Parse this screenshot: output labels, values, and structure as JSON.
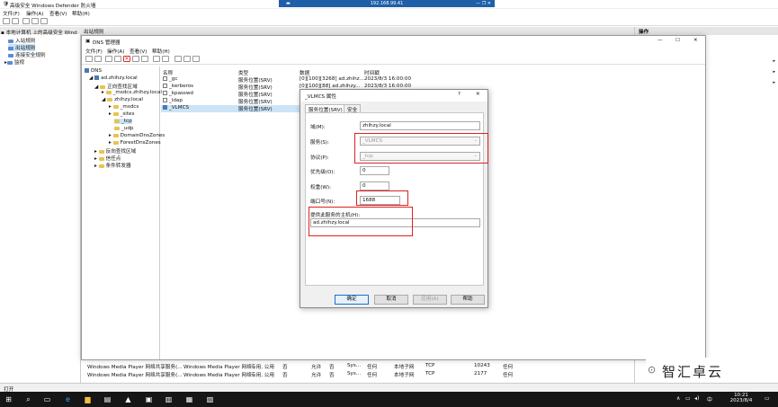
{
  "rdp": {
    "host": "192.168.99.41"
  },
  "firewall": {
    "title": "高级安全 Windows Defender 防火墙",
    "menu": [
      "文件(F)",
      "操作(A)",
      "查看(V)",
      "帮助(H)"
    ],
    "tree_root": "本地计算机 上的高级安全 Wind",
    "tree_items": [
      "入站规则",
      "出站规则",
      "连接安全规则",
      "监视"
    ],
    "center_header": "出站规则",
    "actions_header": "操作",
    "rows": [
      [
        "Windows Media Player 网络共享服务(...",
        "Windows Media Player 网络...",
        "专用, 公用",
        "否",
        "允许",
        "否",
        "Sys...",
        "任何",
        "本地子网",
        "TCP",
        "10243",
        "任何"
      ],
      [
        "Windows Media Player 网络共享服务(...",
        "Windows Media Player 网络...",
        "专用, 公用",
        "否",
        "允许",
        "否",
        "Sys...",
        "任何",
        "本地子网",
        "TCP",
        "2177",
        "任何"
      ]
    ],
    "status": "打开"
  },
  "dns": {
    "title": "DNS 管理器",
    "menu": [
      "文件(F)",
      "操作(A)",
      "查看(V)",
      "帮助(H)"
    ],
    "tree": [
      {
        "label": "DNS",
        "indent": 0
      },
      {
        "label": "ad.zhihzy.local",
        "indent": 1
      },
      {
        "label": "正向查找区域",
        "indent": 2
      },
      {
        "label": "_msdcs.zhihzy.local",
        "indent": 3
      },
      {
        "label": "zhihzy.local",
        "indent": 3
      },
      {
        "label": "_msdcs",
        "indent": 4
      },
      {
        "label": "_sites",
        "indent": 4
      },
      {
        "label": "_tcp",
        "indent": 4
      },
      {
        "label": "_udp",
        "indent": 4
      },
      {
        "label": "DomainDnsZones",
        "indent": 4
      },
      {
        "label": "ForestDnsZones",
        "indent": 4
      },
      {
        "label": "反向查找区域",
        "indent": 2
      },
      {
        "label": "信任点",
        "indent": 2
      },
      {
        "label": "条件转发器",
        "indent": 2
      }
    ],
    "columns": [
      "名称",
      "类型",
      "数据",
      "时间戳"
    ],
    "records": [
      {
        "name": "_gc",
        "type": "服务位置(SRV)",
        "data": "[0][100][3268] ad.zhihz...",
        "ts": "2023/8/3 16:00:00"
      },
      {
        "name": "_kerberos",
        "type": "服务位置(SRV)",
        "data": "[0][100][88] ad.zhihzy...",
        "ts": "2023/8/3 16:00:00"
      },
      {
        "name": "_kpasswd",
        "type": "服务位置(SRV)",
        "data": "",
        "ts": ""
      },
      {
        "name": "_ldap",
        "type": "服务位置(SRV)",
        "data": "",
        "ts": ""
      },
      {
        "name": "_VLMCS",
        "type": "服务位置(SRV)",
        "data": "",
        "ts": ""
      }
    ]
  },
  "dialog": {
    "title": "_VLMCS 属性",
    "help": "?",
    "tabs": [
      "服务位置(SRV)",
      "安全"
    ],
    "domain_label": "域(M):",
    "domain": "zhihzy.local",
    "service_label": "服务(S):",
    "service": "_VLMCS",
    "protocol_label": "协议(P):",
    "protocol": "_tcp",
    "priority_label": "优先级(O):",
    "priority": "0",
    "weight_label": "权重(W):",
    "weight": "0",
    "port_label": "端口号(N):",
    "port": "1688",
    "host_label": "提供此服务的主机(H):",
    "host": "ad.zhihzy.local",
    "ok": "确定",
    "cancel": "取消",
    "apply": "应用(A)",
    "help_btn": "帮助"
  },
  "watermark": "智汇卓云",
  "taskbar": {
    "time": "10:21",
    "date": "2023/8/4",
    "ime": "中"
  }
}
